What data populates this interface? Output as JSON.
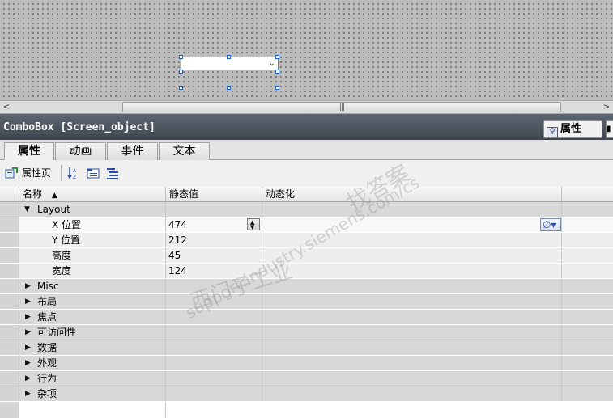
{
  "editor": {
    "combobox_chevron": "⌄",
    "scroll_left": "<",
    "scroll_right": ">",
    "scroll_grip": "|||"
  },
  "inspector": {
    "title": "ComboBox [Screen_object]",
    "side_tab_label": "属性",
    "side_tab_icon": "magnifier-icon"
  },
  "tabs": [
    {
      "label": "属性",
      "active": true
    },
    {
      "label": "动画",
      "active": false
    },
    {
      "label": "事件",
      "active": false
    },
    {
      "label": "文本",
      "active": false
    }
  ],
  "toolbar": {
    "property_page_label": "属性页",
    "icons": [
      "property-page-icon",
      "sort-az-icon",
      "group-icon",
      "list-icon"
    ]
  },
  "grid": {
    "headers": {
      "name": "名称",
      "static_value": "静态值",
      "dynamic": "动态化"
    },
    "sort_indicator": "▲",
    "layout_group": {
      "label": "Layout",
      "rows": [
        {
          "label": "X 位置",
          "value": "474"
        },
        {
          "label": "Y 位置",
          "value": "212"
        },
        {
          "label": "高度",
          "value": "45"
        },
        {
          "label": "宽度",
          "value": "124"
        }
      ]
    },
    "groups": [
      "Misc",
      "布局",
      "焦点",
      "可访问性",
      "数据",
      "外观",
      "行为",
      "杂项"
    ],
    "dynamic_button_symbol": "∅▾"
  },
  "watermark": {
    "line1": "找答案",
    "line2": "support.industry.siemens.com/cs",
    "line3": "西门子工业"
  },
  "colors": {
    "titlebar": "#4b525b",
    "selection_handles": "#1f5fbf",
    "canvas": "#bdbdbd"
  }
}
